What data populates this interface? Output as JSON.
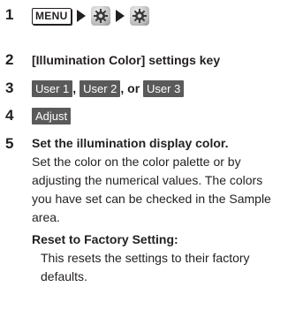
{
  "steps": [
    {
      "number": "1",
      "menu_key": "MENU",
      "gear_icons": [
        "settings-icon",
        "settings-icon"
      ]
    },
    {
      "number": "2",
      "text": "[Illumination Color] settings key"
    },
    {
      "number": "3",
      "buttons": [
        "User 1",
        "User 2",
        "User 3"
      ],
      "sep1": ", ",
      "sep2": ", or "
    },
    {
      "number": "4",
      "button": "Adjust"
    },
    {
      "number": "5",
      "heading": "Set the illumination display color.",
      "body": "Set the color on the color palette or by adjusting the numerical values. The colors you have set can be checked in the Sample area.",
      "sub_title": "Reset to Factory Setting:",
      "sub_body": "This resets the settings to their factory defaults."
    }
  ],
  "colors": {
    "text": "#231f20",
    "chip_bg": "#5a5a5a",
    "chip_text": "#ffffff"
  }
}
